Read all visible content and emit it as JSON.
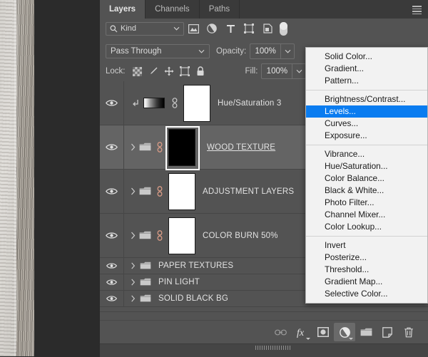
{
  "panel": {
    "tabs": [
      {
        "label": "Layers",
        "active": true
      },
      {
        "label": "Channels",
        "active": false
      },
      {
        "label": "Paths",
        "active": false
      }
    ],
    "menu_icon": "hamburger-menu-icon"
  },
  "filter": {
    "kind_label": "Kind",
    "search_icon": "search-icon",
    "chevron": "∨",
    "icons": [
      {
        "name": "filter-pixel-layers-icon"
      },
      {
        "name": "filter-adjustment-layers-icon"
      },
      {
        "name": "filter-type-layers-icon"
      },
      {
        "name": "filter-shape-layers-icon"
      },
      {
        "name": "filter-smart-object-layers-icon"
      }
    ],
    "toggle_name": "filter-enable-toggle"
  },
  "options": {
    "blend_mode": "Pass Through",
    "opacity_label": "Opacity:",
    "opacity_value": "100%",
    "fill_label": "Fill:",
    "fill_value": "100%",
    "lock_label": "Lock:",
    "lock_icons": [
      {
        "name": "lock-transparent-pixels-icon"
      },
      {
        "name": "lock-image-pixels-icon"
      },
      {
        "name": "lock-position-icon"
      },
      {
        "name": "lock-artboard-nesting-icon"
      },
      {
        "name": "lock-all-icon"
      }
    ]
  },
  "layers": [
    {
      "name": "Hue/Saturation 3",
      "type": "adjustment",
      "visible": true,
      "clipped": true,
      "linked": true,
      "selected": false,
      "thumb": "white",
      "size": "tall"
    },
    {
      "name": "WOOD TEXTURE",
      "type": "group",
      "visible": true,
      "clipped": false,
      "linked": true,
      "selected": true,
      "thumb": "black",
      "size": "tall"
    },
    {
      "name": "ADJUSTMENT LAYERS",
      "type": "group",
      "visible": true,
      "clipped": false,
      "linked": true,
      "selected": false,
      "thumb": "white",
      "size": "tall"
    },
    {
      "name": "COLOR BURN 50%",
      "type": "group",
      "visible": true,
      "clipped": false,
      "linked": true,
      "selected": false,
      "thumb": "white",
      "size": "tall"
    },
    {
      "name": "PAPER TEXTURES",
      "type": "group",
      "visible": true,
      "clipped": false,
      "linked": false,
      "selected": false,
      "thumb": "none",
      "size": "short"
    },
    {
      "name": "PIN LIGHT",
      "type": "group",
      "visible": true,
      "clipped": false,
      "linked": false,
      "selected": false,
      "thumb": "none",
      "size": "short"
    },
    {
      "name": "SOLID BLACK BG",
      "type": "group",
      "visible": true,
      "clipped": false,
      "linked": false,
      "selected": false,
      "thumb": "none",
      "size": "short"
    }
  ],
  "footer_buttons": [
    {
      "name": "link-layers-button",
      "icon": "link-icon",
      "active": false,
      "caret": false
    },
    {
      "name": "layer-style-button",
      "icon": "fx-icon",
      "active": false,
      "caret": true
    },
    {
      "name": "add-layer-mask-button",
      "icon": "mask-icon",
      "active": false,
      "caret": false
    },
    {
      "name": "new-adjustment-layer-button",
      "icon": "adjustment-circle-icon",
      "active": true,
      "caret": true
    },
    {
      "name": "new-group-button",
      "icon": "folder-icon",
      "active": false,
      "caret": false
    },
    {
      "name": "new-layer-button",
      "icon": "new-layer-icon",
      "active": false,
      "caret": false
    },
    {
      "name": "delete-layer-button",
      "icon": "trash-icon",
      "active": false,
      "caret": false
    }
  ],
  "context_menu": {
    "groups": [
      {
        "items": [
          {
            "label": "Solid Color...",
            "highlighted": false
          },
          {
            "label": "Gradient...",
            "highlighted": false
          },
          {
            "label": "Pattern...",
            "highlighted": false
          }
        ]
      },
      {
        "items": [
          {
            "label": "Brightness/Contrast...",
            "highlighted": false
          },
          {
            "label": "Levels...",
            "highlighted": true
          },
          {
            "label": "Curves...",
            "highlighted": false
          },
          {
            "label": "Exposure...",
            "highlighted": false
          }
        ]
      },
      {
        "items": [
          {
            "label": "Vibrance...",
            "highlighted": false
          },
          {
            "label": "Hue/Saturation...",
            "highlighted": false
          },
          {
            "label": "Color Balance...",
            "highlighted": false
          },
          {
            "label": "Black & White...",
            "highlighted": false
          },
          {
            "label": "Photo Filter...",
            "highlighted": false
          },
          {
            "label": "Channel Mixer...",
            "highlighted": false
          },
          {
            "label": "Color Lookup...",
            "highlighted": false
          }
        ]
      },
      {
        "items": [
          {
            "label": "Invert",
            "highlighted": false
          },
          {
            "label": "Posterize...",
            "highlighted": false
          },
          {
            "label": "Threshold...",
            "highlighted": false
          },
          {
            "label": "Gradient Map...",
            "highlighted": false
          },
          {
            "label": "Selective Color...",
            "highlighted": false
          }
        ]
      }
    ]
  },
  "colors": {
    "panel_bg": "#535353",
    "panel_header": "#3a3a3a",
    "selected_row": "#646464",
    "menu_bg": "#f2f2f2",
    "menu_highlight": "#0a7cf0",
    "text": "#e2e2e2",
    "canvas_bg": "#2b2b2b"
  }
}
